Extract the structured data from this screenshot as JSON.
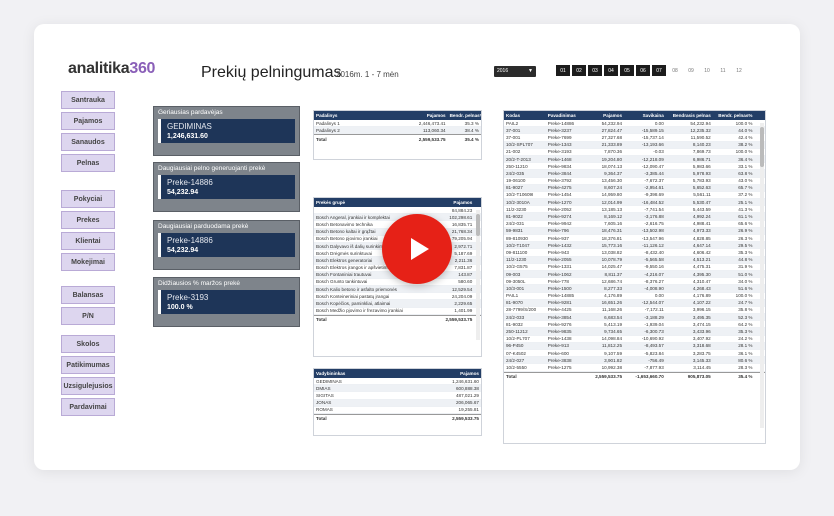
{
  "logo": {
    "text": "analitika",
    "num": "360"
  },
  "title": "Prekių pelningumas",
  "subtitle": "2016m. 1 - 7 mėn",
  "year": "2016",
  "months": [
    {
      "l": "01",
      "on": true
    },
    {
      "l": "02",
      "on": true
    },
    {
      "l": "03",
      "on": true
    },
    {
      "l": "04",
      "on": true
    },
    {
      "l": "05",
      "on": true
    },
    {
      "l": "06",
      "on": true
    },
    {
      "l": "07",
      "on": true
    },
    {
      "l": "08",
      "on": false
    },
    {
      "l": "09",
      "on": false
    },
    {
      "l": "10",
      "on": false
    },
    {
      "l": "11",
      "on": false
    },
    {
      "l": "12",
      "on": false
    }
  ],
  "nav1": [
    "Santrauka",
    "Pajamos",
    "Sanaudos",
    "Pelnas"
  ],
  "nav2": [
    "Pokyciai",
    "Prekes",
    "Klientai",
    "Mokejimai"
  ],
  "nav3": [
    "Balansas",
    "P/N"
  ],
  "nav4": [
    "Skolos",
    "Patikimumas",
    "Uzsigulejusios",
    "Pardavimai"
  ],
  "kpis": [
    {
      "label": "Geriausias pardavėjas",
      "v1": "GEDIMINAS",
      "v2": "1,246,631.60"
    },
    {
      "label": "Daugiausiai pelno generuojanti prekė",
      "v1": "Preke-14886",
      "v2": "54,232.94"
    },
    {
      "label": "Daugiausiai parduodama prekė",
      "v1": "Preke-14886",
      "v2": "54,232.94"
    },
    {
      "label": "Didžiausios % maržos prekė",
      "v1": "Preke-3193",
      "v2": "100.0 %"
    }
  ],
  "t1": {
    "headers": [
      "Padalinys",
      "Pajamos",
      "Bendr. pelnas%"
    ],
    "rows": [
      [
        "Padalinys 1",
        "2,446,473.41",
        "35.3 %"
      ],
      [
        "Padalinys 2",
        "113,060.34",
        "38.4 %"
      ]
    ],
    "total": [
      "Total",
      "2,559,533.75",
      "35.4 %"
    ]
  },
  "t2": {
    "headers": [
      "Prekės grupė",
      "Pajamos"
    ],
    "rows": [
      [
        "",
        "84,884.23"
      ],
      [
        "Bosch Angeral, įrankiai ir komplektai",
        "102,298.61"
      ],
      [
        "Bosch Betonavimo technika",
        "16,835.71"
      ],
      [
        "Bosch Betono kaltai ir grąžtai",
        "21,768.34"
      ],
      [
        "Bosch Betono pjovimo įrankiai",
        "79,205.94"
      ],
      [
        "Bosch Dalyvavo iš dalių surinkimui",
        "2,972.71"
      ],
      [
        "Bosch Drėgmės surinktuvai",
        "5,187.69"
      ],
      [
        "Bosch Elektros generatoriai",
        "2,211.36"
      ],
      [
        "Bosch Elektros įrangos ir apšvietimo technika",
        "7,831.87"
      ],
      [
        "Bosch Fontaniniai trautuvai",
        "143.87"
      ],
      [
        "Bosch Grunto tankintuvai",
        "580.60"
      ],
      [
        "Bosch Kalio betono ir asfalto priemonės",
        "12,529.54"
      ],
      [
        "Bosch Konteineriniai pastatų įrangai",
        "24,204.09"
      ],
      [
        "Bosch Kopėčios, paminkliai, atlaimai",
        "2,229.65"
      ],
      [
        "Bosch Medžio pjovimo ir frezavimo įrankiai",
        "1,401.99"
      ]
    ],
    "total": [
      "Total",
      "2,559,533.75"
    ]
  },
  "t3": {
    "headers": [
      "Vadybininkas",
      "Pajamos"
    ],
    "rows": [
      [
        "GEDIMINAS",
        "1,246,631.60"
      ],
      [
        "DMIAS",
        "600,888.38"
      ],
      [
        "SIGITAS",
        "487,021.29"
      ],
      [
        "JONAS",
        "206,065.67"
      ],
      [
        "ROMAS",
        "19,255.81"
      ]
    ],
    "total": [
      "Total",
      "2,559,533.75"
    ]
  },
  "t4": {
    "headers": [
      "Kodas",
      "Pavadinimas",
      "Pajamos",
      "Savikaina",
      "Bendrasis pelnas",
      "Bendr. pelnas%"
    ],
    "rows": [
      [
        "PAIL2",
        "Preke-14886",
        "54,232.94",
        "0.00",
        "54,232.94",
        "100.0 %"
      ],
      [
        "37-001",
        "Preke-3237",
        "27,824.47",
        "-15,589.15",
        "12,235.32",
        "44.0 %"
      ],
      [
        "37-001",
        "Preke-7699",
        "27,327.68",
        "-15,737.14",
        "11,590.52",
        "42.4 %"
      ],
      [
        "10/2-SPL707",
        "Preke-1343",
        "21,333.89",
        "-13,193.66",
        "8,140.23",
        "38.2 %"
      ],
      [
        "21-002",
        "Preke-3193",
        "7,870.36",
        "-0.03",
        "7,869.73",
        "100.0 %"
      ],
      [
        "20/2-T-2013",
        "Preke-1468",
        "19,204.80",
        "-12,218.09",
        "6,986.71",
        "36.4 %"
      ],
      [
        "250-11210",
        "Preke-9834",
        "18,074.13",
        "-12,090.47",
        "5,983.66",
        "33.1 %"
      ],
      [
        "24/2-035",
        "Preke-3844",
        "9,364.37",
        "-3,385.44",
        "5,978.93",
        "63.8 %"
      ],
      [
        "19-06100",
        "Preke-3792",
        "13,456.30",
        "-7,672.37",
        "5,783.93",
        "43.0 %"
      ],
      [
        "81-9027",
        "Preke-4275",
        "8,607.24",
        "-2,954.61",
        "5,652.63",
        "65.7 %"
      ],
      [
        "10/2-T10609I",
        "Preke-1454",
        "14,959.80",
        "-9,398.69",
        "5,561.11",
        "37.2 %"
      ],
      [
        "10/2-3010A",
        "Preke-1270",
        "12,014.99",
        "-16,484.52",
        "5,530.47",
        "25.1 %"
      ],
      [
        "11/2-3230",
        "Preke-2052",
        "13,185.13",
        "-7,741.54",
        "5,443.59",
        "41.3 %"
      ],
      [
        "81-9022",
        "Preke-9274",
        "8,169.12",
        "-3,176.88",
        "4,992.24",
        "61.1 %"
      ],
      [
        "24/2-031",
        "Preke-9942",
        "7,605.16",
        "-2,616.75",
        "4,988.41",
        "65.6 %"
      ],
      [
        "59-9831",
        "Preke-796",
        "18,476.31",
        "-13,502.98",
        "4,973.33",
        "26.9 %"
      ],
      [
        "89-810930",
        "Preke-937",
        "18,376.81",
        "-13,547.96",
        "4,828.85",
        "26.3 %"
      ],
      [
        "10/2-T1047",
        "Preke-1432",
        "15,773.16",
        "-11,126.12",
        "4,647.14",
        "29.5 %"
      ],
      [
        "09-811100",
        "Preke-943",
        "13,038.82",
        "-8,432.40",
        "4,606.42",
        "35.3 %"
      ],
      [
        "11/2-1230",
        "Preke-2055",
        "10,078.79",
        "-5,565.58",
        "4,513.21",
        "44.8 %"
      ],
      [
        "10/2-G575",
        "Preke-1331",
        "14,025.47",
        "-9,550.16",
        "4,475.31",
        "31.9 %"
      ],
      [
        "09-003",
        "Preke-1062",
        "8,811.37",
        "-4,216.07",
        "4,395.30",
        "51.0 %"
      ],
      [
        "09-3050L",
        "Preke-778",
        "12,686.74",
        "-8,376.27",
        "4,310.47",
        "34.0 %"
      ],
      [
        "10/3-001",
        "Preke-1500",
        "8,277.33",
        "-4,008.90",
        "4,268.43",
        "51.6 %"
      ],
      [
        "PAIL1",
        "Preke-14885",
        "4,176.89",
        "0.00",
        "4,176.89",
        "100.0 %"
      ],
      [
        "81-9070",
        "Preke-9281",
        "16,651.26",
        "-12,544.07",
        "4,107.22",
        "24.7 %"
      ],
      [
        "28-7799/S/200",
        "Preke-4425",
        "11,168.26",
        "-7,172.11",
        "3,996.15",
        "35.8 %"
      ],
      [
        "24/2-033",
        "Preke-3854",
        "6,683.54",
        "-3,188.29",
        "3,495.35",
        "52.3 %"
      ],
      [
        "81-9032",
        "Preke-9276",
        "5,413.19",
        "-1,939.04",
        "3,474.15",
        "64.2 %"
      ],
      [
        "250-11212",
        "Preke-9835",
        "9,734.65",
        "-6,300.73",
        "3,433.96",
        "35.3 %"
      ],
      [
        "10/2-PL707",
        "Preke-1438",
        "14,098.84",
        "-10,690.92",
        "3,407.92",
        "24.2 %"
      ],
      [
        "96-P450",
        "Preke-913",
        "11,812.25",
        "-8,493.57",
        "3,318.68",
        "28.1 %"
      ],
      [
        "07-K4502",
        "Preke-600",
        "9,107.59",
        "-5,823.84",
        "3,283.75",
        "36.1 %"
      ],
      [
        "24/2-027",
        "Preke-3838",
        "3,901.82",
        "-756.49",
        "3,145.33",
        "80.6 %"
      ],
      [
        "10/2-5550",
        "Preke-1275",
        "10,992.38",
        "-7,877.93",
        "3,114.45",
        "28.3 %"
      ]
    ],
    "total": [
      "Total",
      "",
      "2,559,533.75",
      "-1,653,660.70",
      "905,873.05",
      "35.4 %"
    ]
  }
}
